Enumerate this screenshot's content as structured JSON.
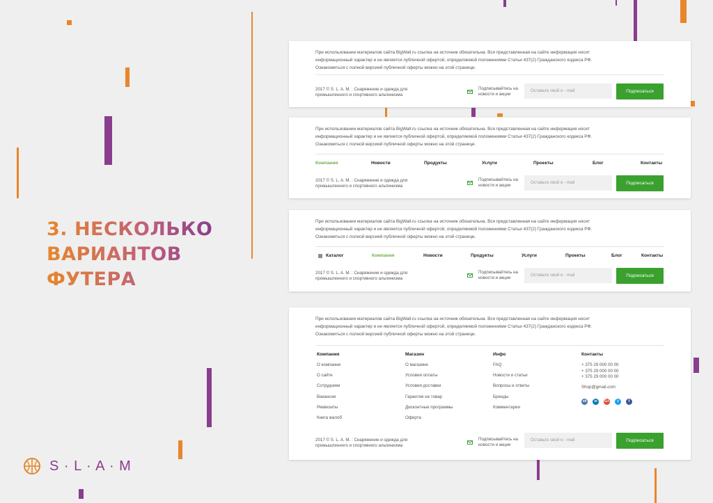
{
  "title": {
    "lines": [
      "3. НЕСКОЛЬКО",
      "ВАРИАНТОВ",
      "ФУТЕРА"
    ]
  },
  "logo": {
    "text": "S · L · A · M"
  },
  "footer": {
    "disclaimer": "При использовании материалов сайта BigWall.ru ссылка на источник обязательна. Вся представленная на сайте информация носит информационный характер и не является публичной офертой, определяемой положениями Статьи 437(2) Гражданского кодекса РФ. Ознакомиться с полной версией публичной оферты можно на этой странице.",
    "copyright": "2017 © S. L. A. M. : Снаряжение и одежда для промышленного и спортивного альпинизма",
    "subscribe_label": "Подписывайтесь на новости и акции",
    "email_placeholder": "Оставьте свой e - mail",
    "subscribe_button": "Подписаться"
  },
  "nav2": [
    "Компания",
    "Новости",
    "Продукты",
    "Услуги",
    "Проекты",
    "Блог",
    "Контакты"
  ],
  "nav3": {
    "catalog": "Каталог",
    "items": [
      "Компания",
      "Новости",
      "Продукты",
      "Услуги",
      "Проекты",
      "Блог",
      "Контакты"
    ]
  },
  "columns": [
    {
      "heading": "Компания",
      "items": [
        "О компании",
        "О сайте",
        "Сотрудники",
        "Вакансии",
        "Реквизиты",
        "Книга жалоб"
      ]
    },
    {
      "heading": "Магазин",
      "items": [
        "О магазине",
        "Условия оплаты",
        "Условия доставки",
        "Гарантия на товар",
        "Дисконтные программы",
        "Оферта"
      ]
    },
    {
      "heading": "Инфо",
      "items": [
        "FAQ",
        "Новости и статьи",
        "Вопросы и ответы",
        "Бренды",
        "Комментарии"
      ]
    }
  ],
  "contacts": {
    "heading": "Контакты",
    "phones": [
      "+ 375 29 000 00 00",
      "+ 375 29 000 00 00",
      "+ 375 29 000 00 00"
    ],
    "email": "Shop@gmail.com",
    "social": [
      {
        "icon": "vk-icon",
        "label": "vk",
        "color": "#4a76a8"
      },
      {
        "icon": "linkedin-icon",
        "label": "in",
        "color": "#0077b5"
      },
      {
        "icon": "google-plus-icon",
        "label": "G+",
        "color": "#dd4b39"
      },
      {
        "icon": "twitter-icon",
        "label": "t",
        "color": "#1da1f2"
      },
      {
        "icon": "facebook-icon",
        "label": "f",
        "color": "#3b5998"
      }
    ]
  },
  "colors": {
    "orange": "#e8862b",
    "purple": "#8a3d8e",
    "green": "#3aa12f",
    "active_nav": "#6ab04c"
  }
}
